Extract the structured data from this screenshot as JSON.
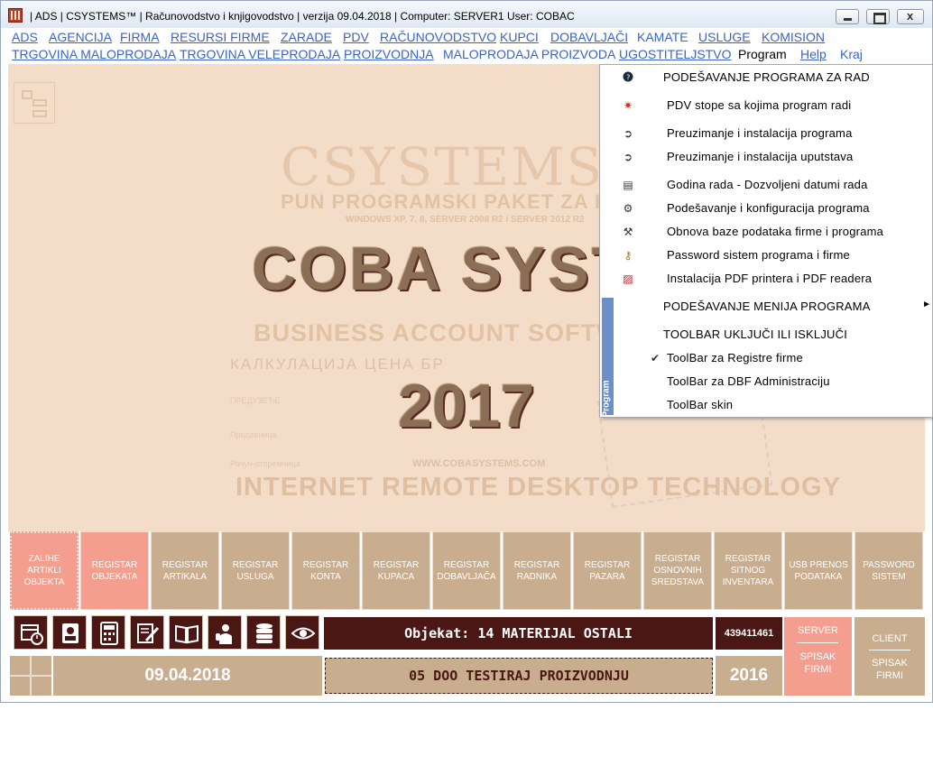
{
  "window": {
    "title": "| ADS | CSYSTEMS™ | Računovodstvo i knjigovodstvo |   verzija 09.04.2018  |  Computer: SERVER1  User: COBAC"
  },
  "menu": {
    "row1": [
      "ADS",
      "AGENCIJA",
      "FIRMA",
      "RESURSI FIRME",
      "ZARADE",
      "PDV",
      "RAČUNOVODSTVO",
      "KUPCI",
      "DOBAVLJAČI",
      "KAMATE",
      "USLUGE",
      "KOMISION"
    ],
    "row2": [
      "TRGOVINA MALOPRODAJA",
      "TRGOVINA VELEPRODAJA",
      "PROIZVODNJA",
      "MALOPRODAJA PROIZVODA",
      "UGOSTITELJSTVO",
      "Program",
      "Help",
      "Kraj"
    ]
  },
  "background": {
    "csystems": "CSYSTEMS",
    "pun": "PUN PROGRAMSKI PAKET ZA KNJIGOVODSTV",
    "windows": "WINDOWS XP, 7, 8, SERVER 2008 R2 i SERVER 2012 R2",
    "coba": "COBA SYSTE",
    "business": "BUSINESS ACCOUNT SOFTWARE TECH",
    "kalk": "КАЛКУЛАЦИЈА  ЦЕНА БР",
    "year": "2017",
    "web": "WWW.COBASYSTEMS.COM",
    "internet": "INTERNET REMOTE DESKTOP TECHNOLOGY",
    "faint1": "ПРЕДУЗЕЋЕ",
    "faint2": "Продавница",
    "faint3": "Рачун-отпремница"
  },
  "dropdown": {
    "sidebar_label": "Program",
    "items": [
      {
        "label": "PODEŠAVANJE PROGRAMA ZA RAD",
        "icon": "help-icon"
      },
      {
        "label": "PDV stope sa kojima program radi",
        "icon": "star-icon"
      },
      {
        "label": "Preuzimanje i instalacija programa",
        "icon": "download-icon"
      },
      {
        "label": "Preuzimanje i instalacija uputstava",
        "icon": "download-icon"
      },
      {
        "label": "Godina rada - Dozvoljeni datumi rada",
        "icon": "calendar-icon"
      },
      {
        "label": "Podešavanje i konfiguracija programa",
        "icon": "settings-icon"
      },
      {
        "label": "Obnova baze podataka firme i programa",
        "icon": "tools-icon"
      },
      {
        "label": "Password sistem programa i firme",
        "icon": "key-icon"
      },
      {
        "label": "Instalacija PDF printera i PDF readera",
        "icon": "pdf-icon"
      },
      {
        "label": "PODEŠAVANJE MENIJA PROGRAMA",
        "icon": "submenu-arrow-icon"
      },
      {
        "label": "TOOLBAR UKLJUČI ILI ISKLJUČI",
        "icon": ""
      },
      {
        "label": "ToolBar za Registre firme",
        "icon": "check-icon",
        "checked": true
      },
      {
        "label": "ToolBar za DBF Administraciju",
        "icon": ""
      },
      {
        "label": "ToolBar skin",
        "icon": ""
      }
    ]
  },
  "registers": [
    {
      "label": "ZALIHE ARTIKLI OBJEKTA",
      "style": "dots"
    },
    {
      "label": "REGISTAR OBJEKATA",
      "style": "pink"
    },
    {
      "label": "REGISTAR ARTIKALA",
      "style": "normal"
    },
    {
      "label": "REGISTAR USLUGA",
      "style": "normal"
    },
    {
      "label": "REGISTAR KONTA",
      "style": "normal"
    },
    {
      "label": "REGISTAR KUPACA",
      "style": "normal"
    },
    {
      "label": "REGISTAR DOBAVLJAČA",
      "style": "normal"
    },
    {
      "label": "REGISTAR RADNIKA",
      "style": "normal"
    },
    {
      "label": "REGISTAR PAZARA",
      "style": "normal"
    },
    {
      "label": "REGISTAR OSNOVNIH SREDSTAVA",
      "style": "normal"
    },
    {
      "label": "REGISTAR SITNOG INVENTARA",
      "style": "normal"
    },
    {
      "label": "USB PRENOS PODATAKA",
      "style": "normal"
    },
    {
      "label": "PASSWORD SISTEM",
      "style": "normal"
    }
  ],
  "toolbar": {
    "icons": [
      "calendar-clock-icon",
      "contacts-icon",
      "calculator-icon",
      "edit-document-icon",
      "book-icon",
      "user-phone-icon",
      "database-icon",
      "eye-icon"
    ]
  },
  "status": {
    "objekat": "Objekat: 14  MATERIJAL OSTALI",
    "code": "439411461",
    "date": "09.04.2018",
    "firm": "05  DOO TESTIRAJ PROIZVODNJU",
    "year": "2016",
    "server_label": "SERVER",
    "server_spisak": "SPISAK FIRMI",
    "client_label": "CLIENT",
    "client_spisak": "SPISAK FIRMI"
  },
  "colors": {
    "accent_dark": "#4a1714",
    "tan": "#c9ad8f",
    "pink": "#f49e8f",
    "menu_link": "#3a63c8",
    "background": "#f3ddc9"
  }
}
